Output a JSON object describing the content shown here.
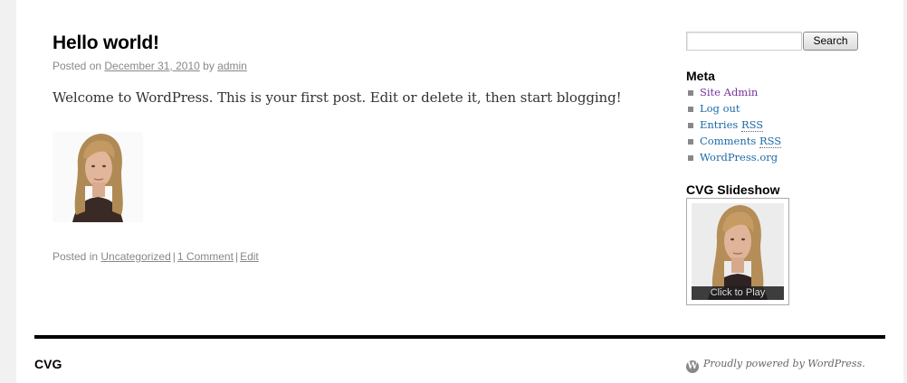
{
  "post": {
    "title": "Hello world!",
    "posted_on_prefix": "Posted on",
    "date": "December 31, 2010",
    "by": "by",
    "author": "admin",
    "content": "Welcome to WordPress. This is your first post. Edit or delete it, then start blogging!",
    "posted_in_prefix": "Posted in",
    "category": "Uncategorized",
    "comments": "1 Comment",
    "edit": "Edit",
    "separator": "|"
  },
  "sidebar": {
    "search_button": "Search",
    "search_value": "",
    "meta_title": "Meta",
    "meta_items": [
      {
        "label": "Site Admin",
        "visited": true
      },
      {
        "label": "Log out",
        "visited": false
      },
      {
        "label": "Entries",
        "suffix": "RSS",
        "visited": false
      },
      {
        "label": "Comments",
        "suffix": "RSS",
        "visited": false
      },
      {
        "label": "WordPress.org",
        "visited": false
      }
    ],
    "slideshow_title": "CVG Slideshow",
    "slideshow_play": "Click to Play"
  },
  "footer": {
    "site_name": "CVG",
    "powered": "Proudly powered by WordPress.",
    "icon": "wordpress-logo-icon",
    "icon_glyph": "W"
  },
  "colors": {
    "link": "#1a6aa8",
    "visited_link": "#743399",
    "meta_text": "#888888"
  }
}
